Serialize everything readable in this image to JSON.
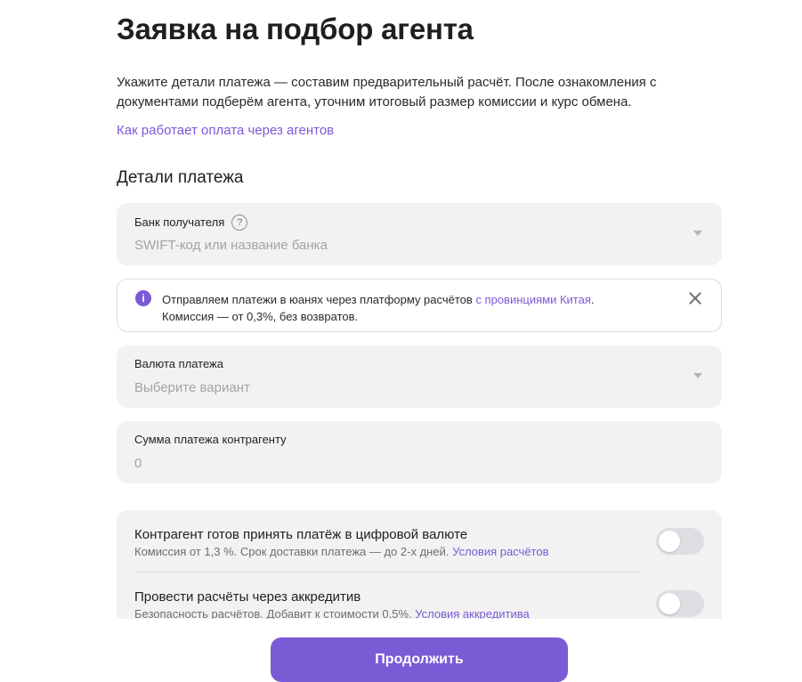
{
  "page": {
    "title": "Заявка на подбор агента",
    "intro": "Укажите детали платежа — составим предварительный расчёт. После ознакомления с документами подберём агента, уточним итоговый размер комиссии и курс обмена.",
    "how_link": "Как работает оплата через агентов",
    "section_title": "Детали платежа"
  },
  "bank": {
    "label": "Банк получателя",
    "help_icon": "?",
    "placeholder": "SWIFT-код или название банка"
  },
  "notice": {
    "icon": "i",
    "text_before": "Отправляем платежи в юанях через платформу расчётов ",
    "link": "с провинциями Китая",
    "text_after": ".",
    "line2": "Комиссия — от 0,3%, без возвратов."
  },
  "currency": {
    "label": "Валюта платежа",
    "placeholder": "Выберите вариант"
  },
  "amount": {
    "label": "Сумма платежа контрагенту",
    "value": "0"
  },
  "options": [
    {
      "title": "Контрагент готов принять платёж в цифровой валюте",
      "subtitle": "Комиссия от 1,3 %. Срок доставки платежа — до 2-х дней. ",
      "link": "Условия расчётов",
      "enabled": false
    },
    {
      "title": "Провести расчёты через аккредитив",
      "subtitle": "Безопасность расчётов. Добавит к стоимости 0,5%. ",
      "link": "Условия аккредитива",
      "enabled": false
    }
  ],
  "submit_label": "Продолжить",
  "colors": {
    "accent": "#7b5ad6",
    "field_bg": "#f2f2f3",
    "text": "#1f1f22",
    "muted": "#a3a3a8"
  }
}
